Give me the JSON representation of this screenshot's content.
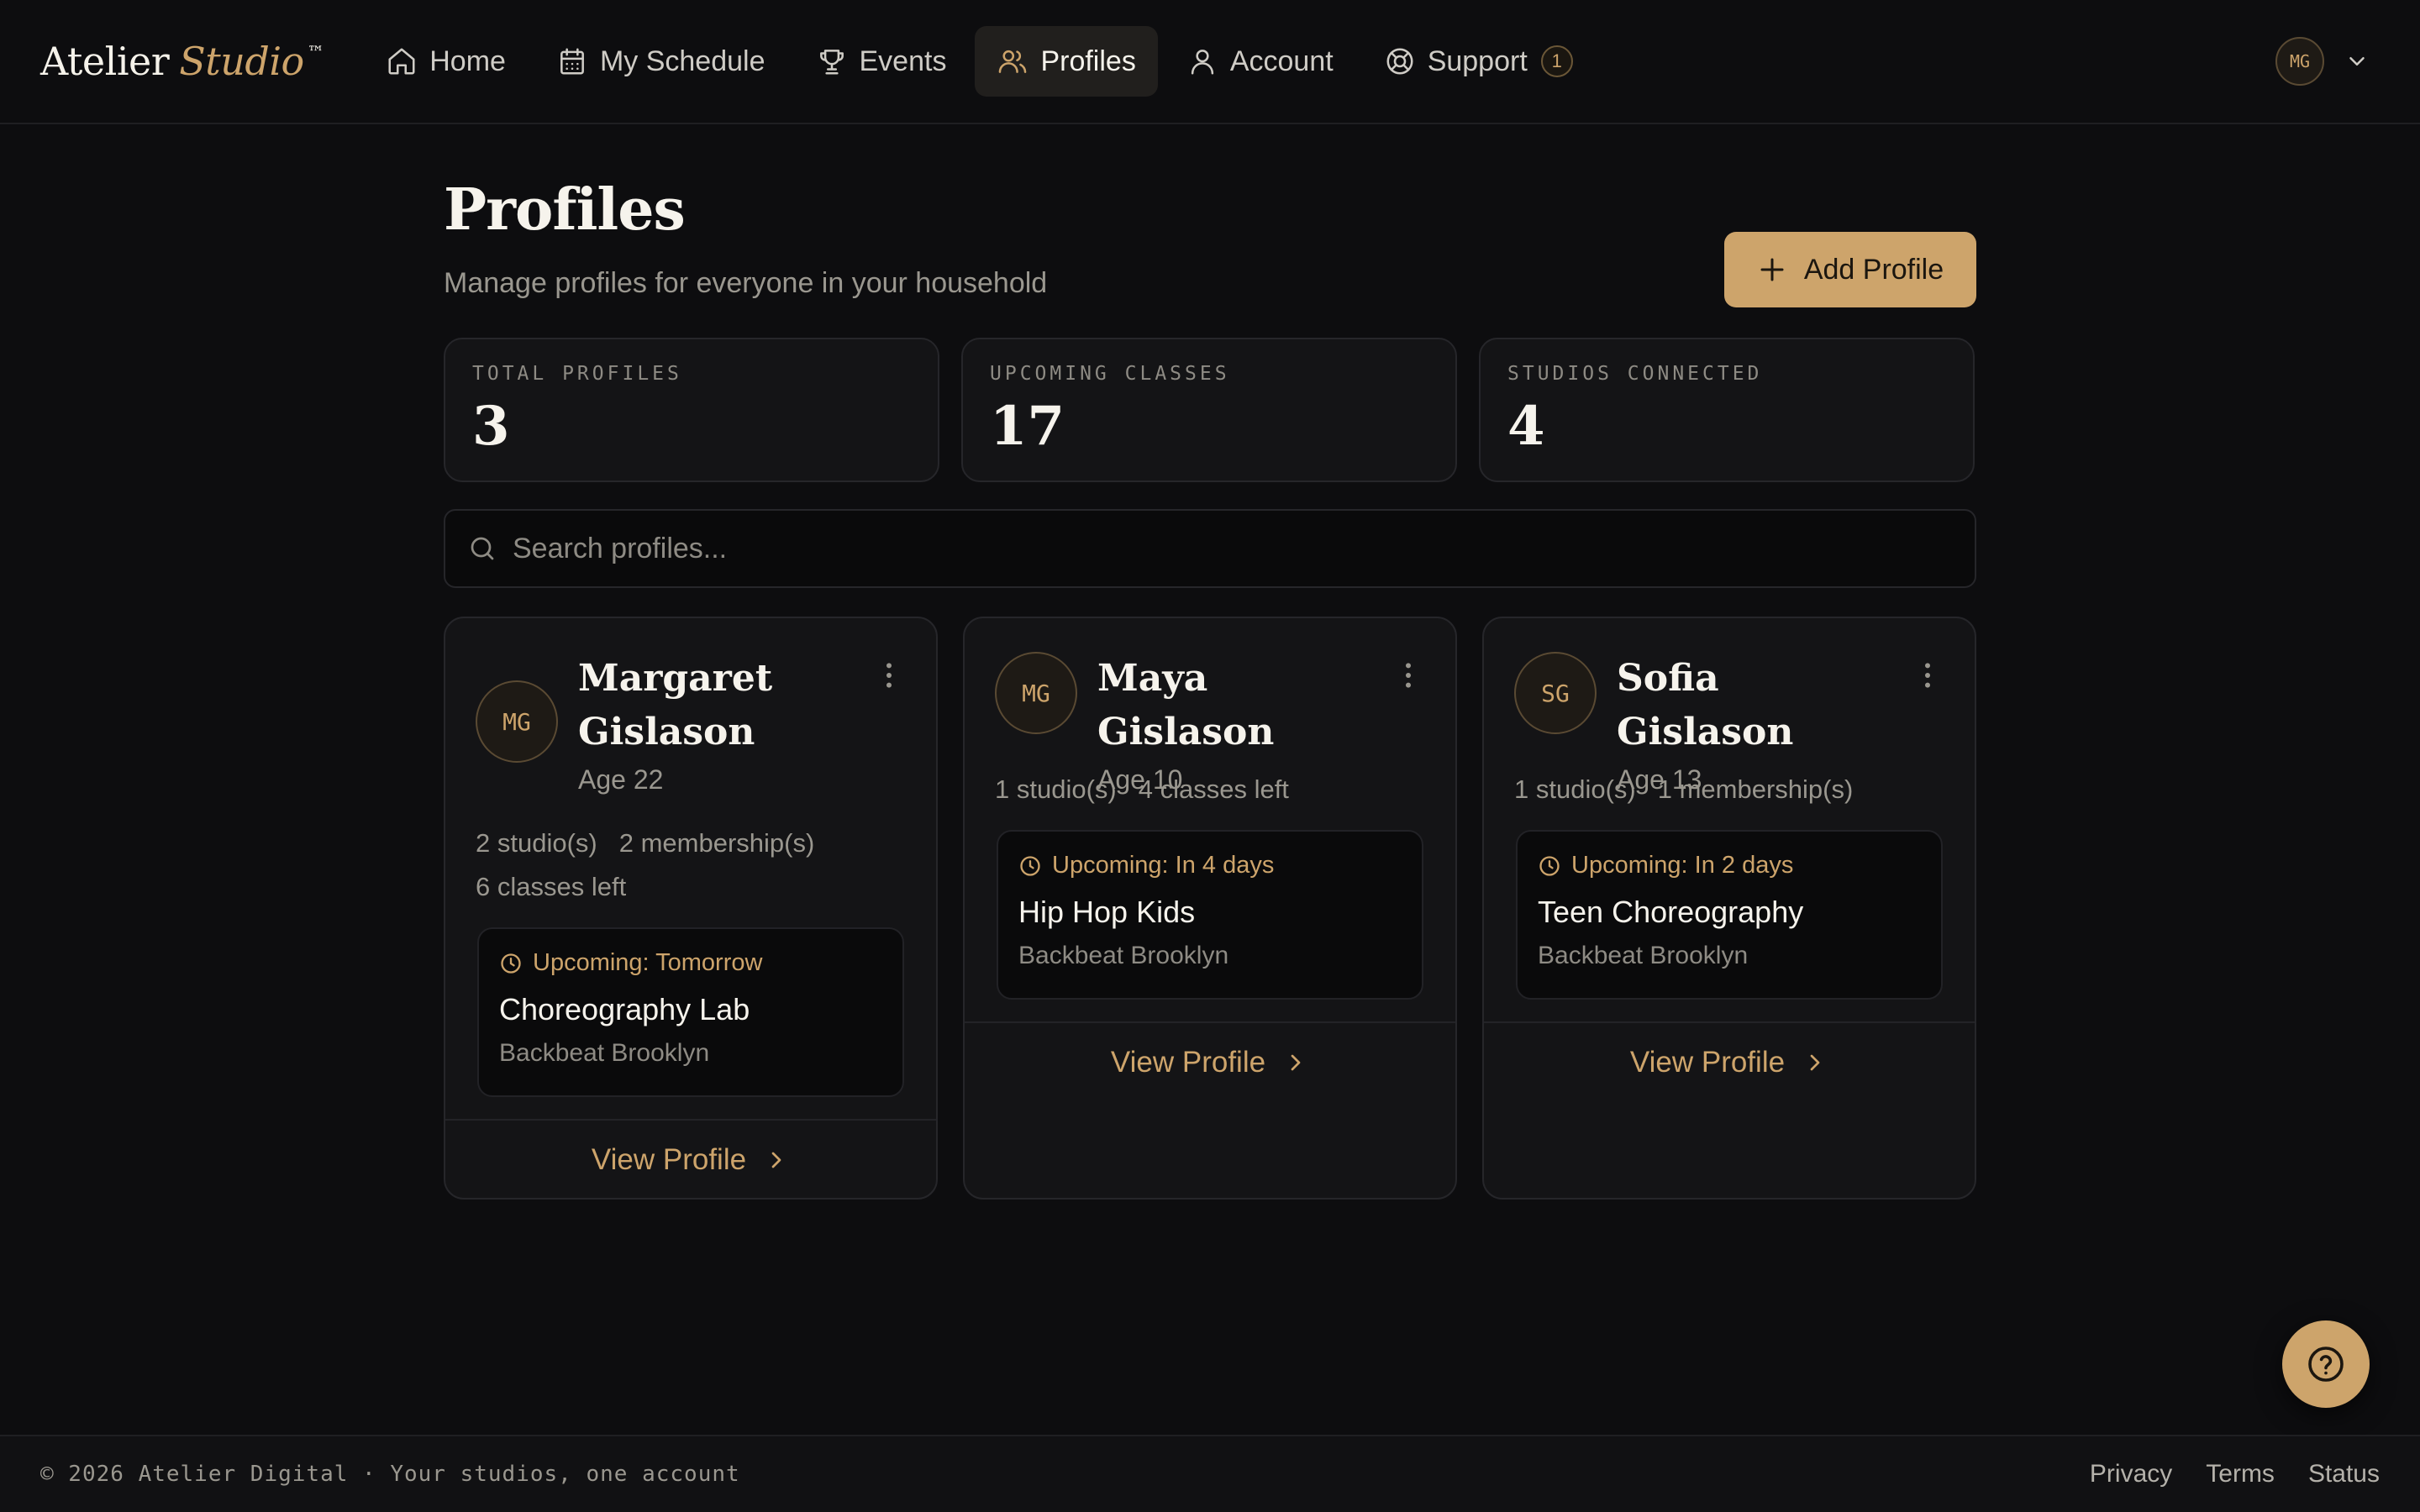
{
  "brand": {
    "name": "Atelier",
    "accent": "Studio",
    "tm": "™"
  },
  "nav": {
    "items": [
      {
        "label": "Home",
        "icon": "home-icon"
      },
      {
        "label": "My Schedule",
        "icon": "calendar-icon"
      },
      {
        "label": "Events",
        "icon": "trophy-icon"
      },
      {
        "label": "Profiles",
        "icon": "users-icon",
        "active": true
      },
      {
        "label": "Account",
        "icon": "user-icon"
      },
      {
        "label": "Support",
        "icon": "lifebuoy-icon",
        "badge": "1"
      }
    ]
  },
  "user": {
    "initials": "MG"
  },
  "page": {
    "title": "Profiles",
    "subtitle": "Manage profiles for everyone in your household",
    "add_button": "Add Profile"
  },
  "stats": [
    {
      "label": "TOTAL PROFILES",
      "value": "3"
    },
    {
      "label": "UPCOMING CLASSES",
      "value": "17"
    },
    {
      "label": "STUDIOS CONNECTED",
      "value": "4"
    }
  ],
  "search": {
    "placeholder": "Search profiles..."
  },
  "profiles": [
    {
      "initials": "MG",
      "name_line1": "Margaret",
      "name_line2": "Gislason",
      "age": "Age 22",
      "meta": [
        "2 studio(s)",
        "2 membership(s)",
        "6 classes left"
      ],
      "upcoming": {
        "when": "Upcoming: Tomorrow",
        "class": "Choreography Lab",
        "studio": "Backbeat Brooklyn"
      },
      "view": "View Profile"
    },
    {
      "initials": "MG",
      "name": "Maya Gislason",
      "age": "Age 10",
      "meta": [
        "1 studio(s)",
        "4 classes left"
      ],
      "upcoming": {
        "when": "Upcoming: In 4 days",
        "class": "Hip Hop Kids",
        "studio": "Backbeat Brooklyn"
      },
      "view": "View Profile"
    },
    {
      "initials": "SG",
      "name": "Sofia Gislason",
      "age": "Age 13",
      "meta": [
        "1 studio(s)",
        "1 membership(s)"
      ],
      "upcoming": {
        "when": "Upcoming: In 2 days",
        "class": "Teen Choreography",
        "studio": "Backbeat Brooklyn"
      },
      "view": "View Profile"
    }
  ],
  "footer": {
    "copyright": "© 2026 Atelier Digital · Your studios, one account",
    "links": [
      "Privacy",
      "Terms",
      "Status"
    ]
  },
  "colors": {
    "accent": "#cda46b",
    "background": "#0d0d0f",
    "card": "#141416"
  }
}
